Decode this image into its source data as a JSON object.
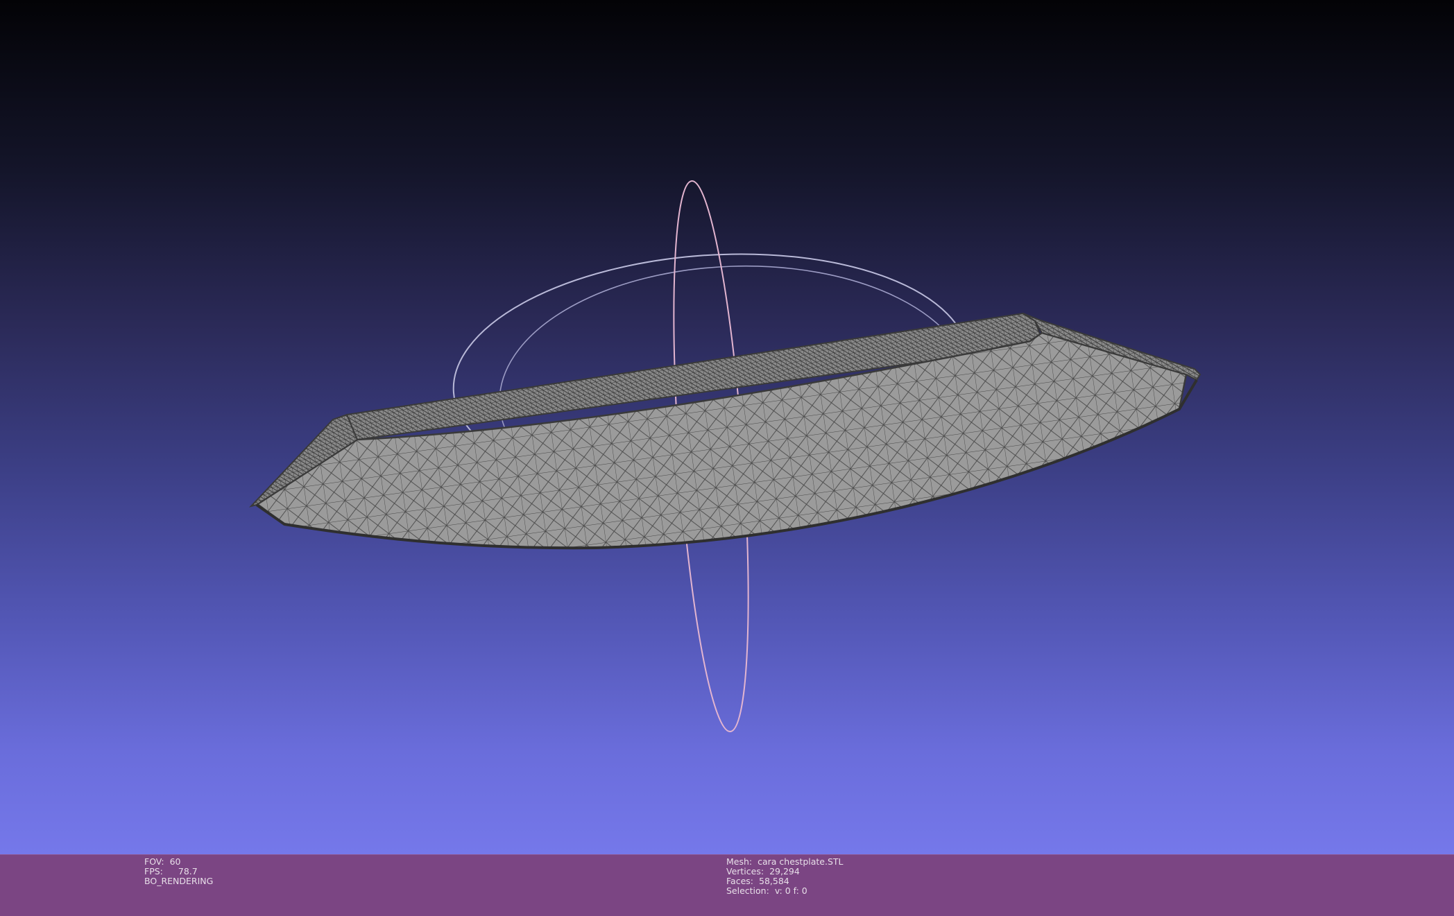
{
  "viewport": {
    "background_top": "#030306",
    "background_bottom": "#7578ea",
    "trackball_colors": {
      "horizontal_ring": "#b9b9d8",
      "vertical_ring": "#e8b9d4"
    },
    "mesh_fill": "#9a9a9a",
    "mesh_wire": "#3e3e3e"
  },
  "status_left": {
    "fov_label": "FOV:",
    "fov_value": "60",
    "fps_label": "FPS:",
    "fps_value": "78.7",
    "render_mode": "BO_RENDERING"
  },
  "status_right": {
    "mesh_label": "Mesh:",
    "mesh_value": "cara chestplate.STL",
    "vertices_label": "Vertices:",
    "vertices_value": "29,294",
    "faces_label": "Faces:",
    "faces_value": "58,584",
    "selection_label": "Selection:",
    "selection_value": "v: 0 f: 0"
  },
  "colors": {
    "status_bar": "#7b4583",
    "status_text": "#e8dfe9"
  }
}
